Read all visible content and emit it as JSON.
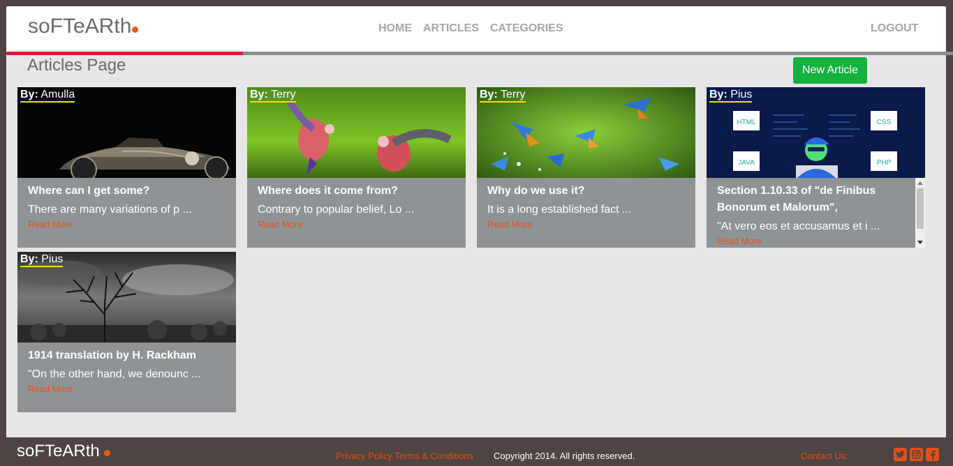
{
  "header": {
    "brand": "soFTeARth",
    "nav": [
      "HOME",
      "ARTICLES",
      "CATEGORIES"
    ],
    "logout": "LOGOUT"
  },
  "progress": {
    "value": 0.25,
    "color": "#e5163a"
  },
  "main": {
    "page_title": "Articles Page",
    "new_article_label": "New Article"
  },
  "cards": [
    {
      "by_label": "By:",
      "author": "Amulla",
      "title": "Where can I get some?",
      "excerpt": "There are many variations of p ...",
      "read_more": "Read More",
      "image": "vintage-car"
    },
    {
      "by_label": "By:",
      "author": "Terry",
      "title": "Where does it come from?",
      "excerpt": "Contrary to popular belief, Lo ...",
      "read_more": "Read More",
      "image": "parrots"
    },
    {
      "by_label": "By:",
      "author": "Terry",
      "title": "Why do we use it?",
      "excerpt": "It is a long established fact ...",
      "read_more": "Read More",
      "image": "kingfishers"
    },
    {
      "by_label": "By:",
      "author": "Pius",
      "title": "Section 1.10.33 of \"de Finibus Bonorum et Malorum\",",
      "excerpt": "\"At vero eos et accusamus et i ...",
      "read_more": "Read More",
      "image": "developer-illustration",
      "image_labels": [
        "HTML",
        "CSS",
        "JAVA",
        "PHP"
      ]
    },
    {
      "by_label": "By:",
      "author": "Pius",
      "title": "1914 translation by H. Rackham",
      "excerpt": "\"On the other hand, we denounc ...",
      "read_more": "Read More",
      "image": "bw-tree"
    }
  ],
  "footer": {
    "brand": "soFTeARth",
    "privacy": "Privacy Policy",
    "terms": "Terms & Conditions",
    "copyright": "Copyright 2014. All rights reserved.",
    "contact": "Contact Us:",
    "social": [
      "twitter-icon",
      "instagram-icon",
      "facebook-icon"
    ]
  },
  "colors": {
    "accent": "#e84f14",
    "button": "#13b13e",
    "card": "#8f9396",
    "byline_underline": "#f0e000"
  }
}
